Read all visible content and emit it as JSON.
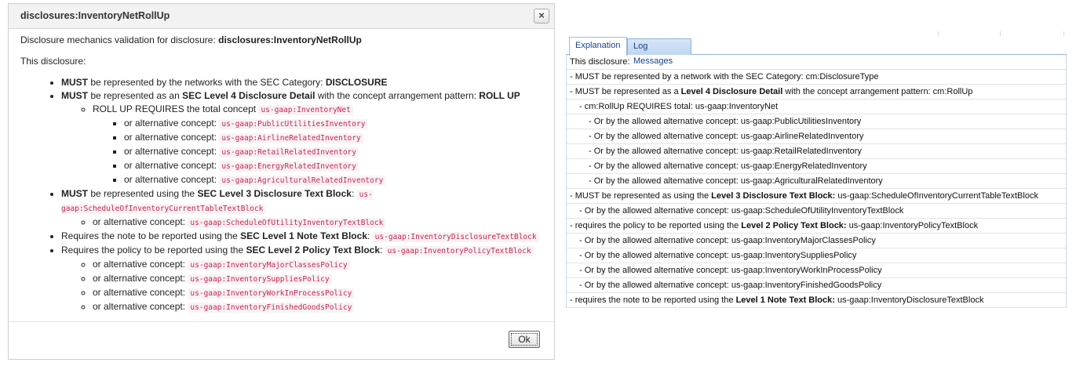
{
  "dialog": {
    "title": "disclosures:InventoryNetRollUp",
    "close_icon": "×",
    "intro_prefix": "Disclosure mechanics validation for disclosure: ",
    "intro_name": "disclosures:InventoryNetRollUp",
    "lead": "This disclosure:",
    "items": {
      "i1": {
        "must": "MUST",
        "text": " be represented by the networks with the SEC Category: ",
        "strong": "DISCLOSURE"
      },
      "i2": {
        "must": "MUST",
        "text": " be represented as an ",
        "strong": "SEC Level 4 Disclosure Detail",
        "text2": " with the concept arrangement pattern: ",
        "strong2": "ROLL UP",
        "sub_text": "ROLL UP REQUIRES the total concept ",
        "sub_code": "us-gaap:InventoryNet",
        "alt_label": "or alternative concept: ",
        "alts": [
          "us-gaap:PublicUtilitiesInventory",
          "us-gaap:AirlineRelatedInventory",
          "us-gaap:RetailRelatedInventory",
          "us-gaap:EnergyRelatedInventory",
          "us-gaap:AgriculturalRelatedInventory"
        ]
      },
      "i3": {
        "must": "MUST",
        "text": " be represented using the ",
        "strong": "SEC Level 3 Disclosure Text Block",
        "text2": ": ",
        "code": "us-gaap:ScheduleOfInventoryCurrentTableTextBlock",
        "alt_label": "or alternative concept: ",
        "alt": "us-gaap:ScheduleOfUtilityInventoryTextBlock"
      },
      "i4": {
        "text": "Requires the note to be reported using the ",
        "strong": "SEC Level 1 Note Text Block",
        "text2": ": ",
        "code": "us-gaap:InventoryDisclosureTextBlock"
      },
      "i5": {
        "text": "Requires the policy to be reported using the ",
        "strong": "SEC Level 2 Policy Text Block",
        "text2": ": ",
        "code": "us-gaap:InventoryPolicyTextBlock",
        "alt_label": "or alternative concept: ",
        "alts": [
          "us-gaap:InventoryMajorClassesPolicy",
          "us-gaap:InventorySuppliesPolicy",
          "us-gaap:InventoryWorkInProcessPolicy",
          "us-gaap:InventoryFinishedGoodsPolicy"
        ]
      }
    },
    "ok_label": "Ok"
  },
  "panel": {
    "tabs": [
      "Explanation",
      "Log Messages"
    ],
    "rows": {
      "r0": "This disclosure:",
      "r1": "- MUST be represented by a network with the SEC Category: cm:DisclosureType",
      "r2": {
        "pre": "- MUST be represented as a ",
        "b": "Level 4 Disclosure Detail",
        "post": " with the concept arrangement pattern: cm:RollUp"
      },
      "r3": "- cm:RollUp REQUIRES total: us-gaap:InventoryNet",
      "r4": "- Or by the allowed alternative concept: us-gaap:PublicUtilitiesInventory",
      "r5": "- Or by the allowed alternative concept: us-gaap:AirlineRelatedInventory",
      "r6": "- Or by the allowed alternative concept: us-gaap:RetailRelatedInventory",
      "r7": "- Or by the allowed alternative concept: us-gaap:EnergyRelatedInventory",
      "r8": "- Or by the allowed alternative concept: us-gaap:AgriculturalRelatedInventory",
      "r9": {
        "pre": "- MUST be represented as using the ",
        "b": "Level 3 Disclosure Text Block:",
        "post": " us-gaap:ScheduleOfInventoryCurrentTableTextBlock"
      },
      "r10": "- Or by the allowed alternative concept: us-gaap:ScheduleOfUtilityInventoryTextBlock",
      "r11": {
        "pre": "- requires the policy to be reported using the ",
        "b": "Level 2 Policy Text Block:",
        "post": " us-gaap:InventoryPolicyTextBlock"
      },
      "r12": "- Or by the allowed alternative concept: us-gaap:InventoryMajorClassesPolicy",
      "r13": "- Or by the allowed alternative concept: us-gaap:InventorySuppliesPolicy",
      "r14": "- Or by the allowed alternative concept: us-gaap:InventoryWorkInProcessPolicy",
      "r15": "- Or by the allowed alternative concept: us-gaap:InventoryFinishedGoodsPolicy",
      "r16": {
        "pre": "- requires the note to be reported using the ",
        "b": "Level 1 Note Text Block:",
        "post": " us-gaap:InventoryDisclosureTextBlock"
      }
    }
  },
  "colors": {
    "code_fg": "#c7254e",
    "code_bg": "#f9f2f4",
    "tab_border": "#8eb4d8",
    "tab_text": "#15428b"
  }
}
